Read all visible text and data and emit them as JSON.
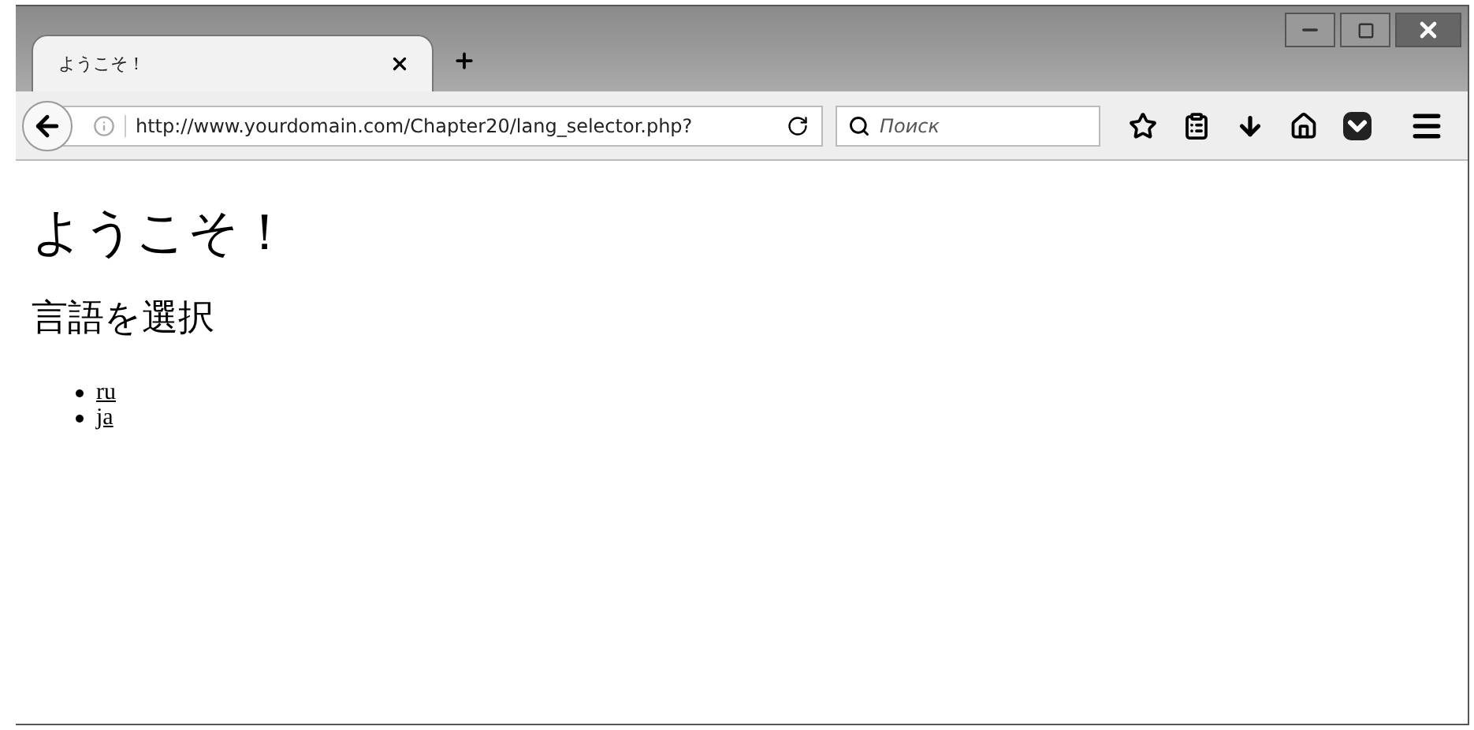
{
  "tabs": [
    {
      "title": "ようこそ！",
      "selected": true
    }
  ],
  "address_bar": {
    "url": "http://www.yourdomain.com/Chapter20/lang_selector.php?"
  },
  "search": {
    "placeholder": "Поиск"
  },
  "page": {
    "heading": "ようこそ！",
    "subheading": "言語を選択",
    "links": [
      "ru",
      "ja"
    ]
  }
}
